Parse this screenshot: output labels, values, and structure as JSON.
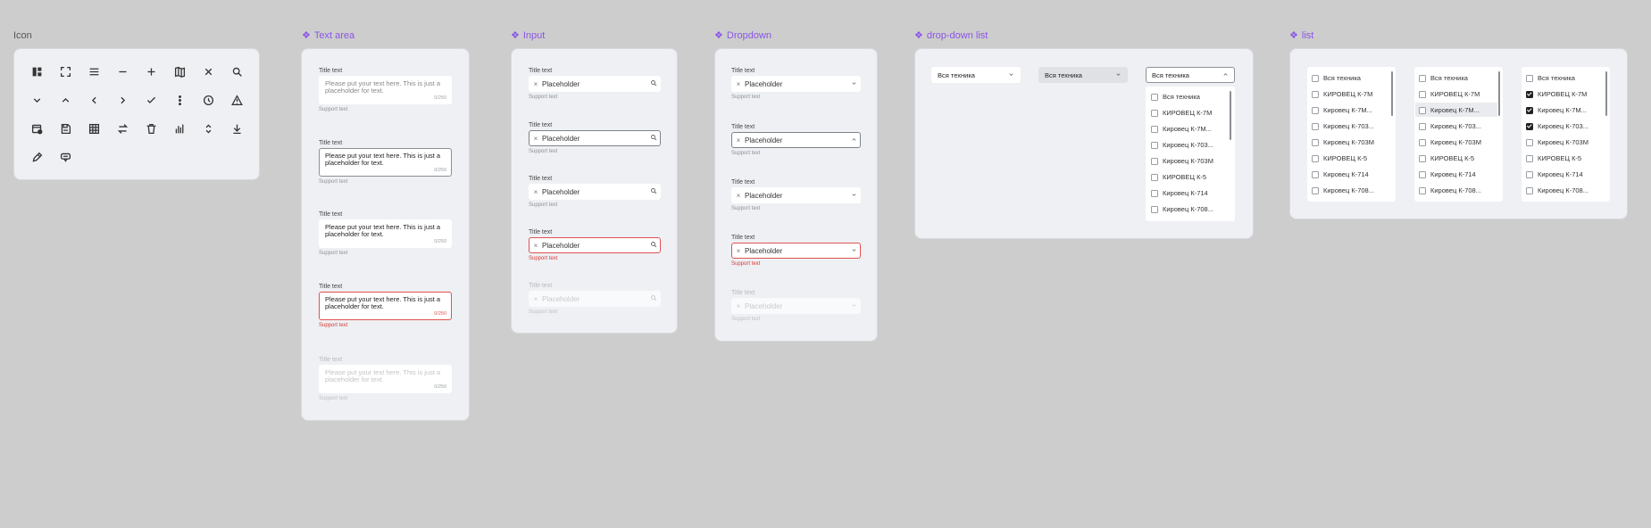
{
  "sections": {
    "icon": "Icon",
    "text_area": "Text area",
    "input": "Input",
    "dropdown": "Dropdown",
    "dropdown_list": "drop-down list",
    "list": "list"
  },
  "icons": [
    [
      "dashboard-icon",
      "fullscreen-icon",
      "menu-icon",
      "minus-icon",
      "plus-icon",
      "map-icon",
      "close-icon",
      "search-icon"
    ],
    [
      "chevron-down-icon",
      "chevron-up-icon",
      "chevron-left-icon",
      "chevron-right-icon",
      "check-icon",
      "more-vertical-icon",
      "clock-icon",
      "warning-icon"
    ],
    [
      "calendar-settings-icon",
      "save-icon",
      "grid-icon",
      "swap-icon",
      "trash-icon",
      "bar-chart-icon",
      "sort-icon",
      "download-icon"
    ],
    [
      "pencil-icon",
      "comment-icon"
    ]
  ],
  "text_area": {
    "label": "Title text",
    "support": "Support text",
    "text": "Please put your text here. This is just a placeholder for text.",
    "counter": "0/250"
  },
  "input": {
    "label": "Title text",
    "support": "Support text",
    "placeholder": "Placeholder",
    "clear": "×"
  },
  "dropdown": {
    "label": "Title text",
    "support": "Support text",
    "placeholder": "Placeholder",
    "clear": "×"
  },
  "dropdown_list": {
    "selected": "Вся техника",
    "items": [
      "Вся техника",
      "КИРОВЕЦ К-7М",
      "Кировец К-7М...",
      "Кировец К-703...",
      "Кировец К-703М",
      "КИРОВЕЦ К-5",
      "Кировец К-714",
      "Кировец К-708..."
    ]
  },
  "list": {
    "items": [
      "Вся техника",
      "КИРОВЕЦ К-7М",
      "Кировец К-7М...",
      "Кировец К-703...",
      "Кировец К-703М",
      "КИРОВЕЦ К-5",
      "Кировец К-714",
      "Кировец К-708..."
    ],
    "checked_third": [
      false,
      true,
      true,
      true,
      false,
      false,
      false,
      false
    ]
  },
  "colors": {
    "accent": "#8a55e6",
    "error": "#e05252",
    "panel": "#eef0f3",
    "canvas": "#cdcdcd"
  }
}
